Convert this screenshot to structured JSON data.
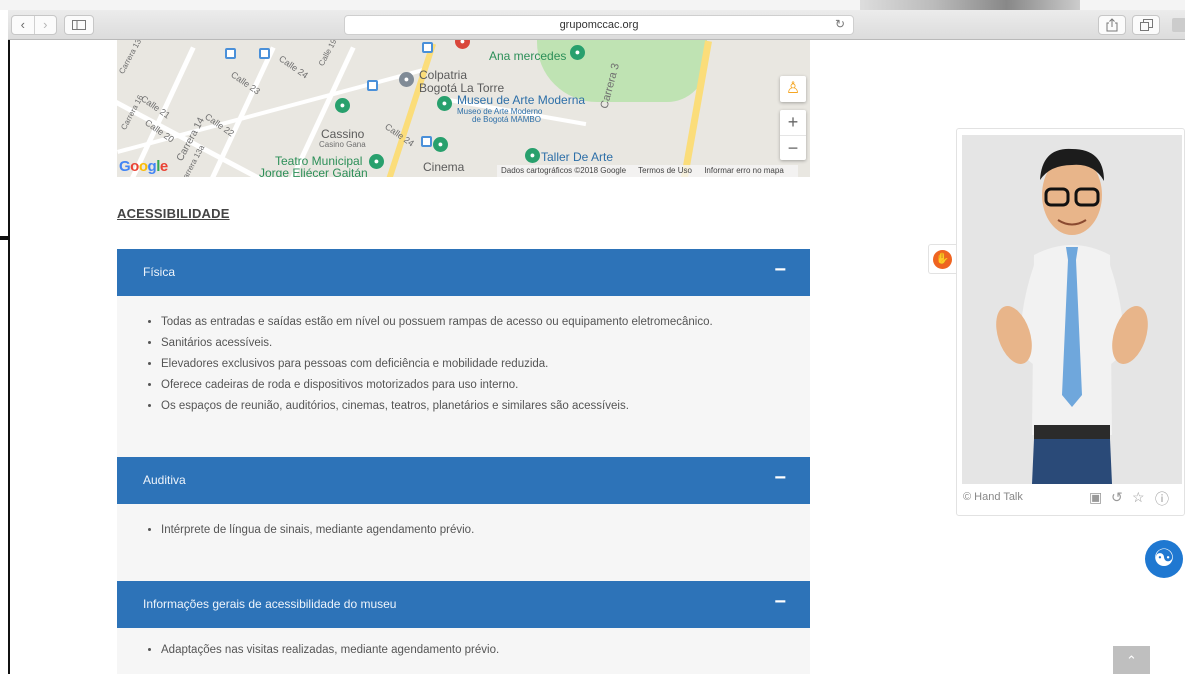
{
  "browser": {
    "url": "grupomccac.org",
    "back_icon": "chevron-left-icon",
    "forward_icon": "chevron-right-icon"
  },
  "map": {
    "labels": {
      "ana_mercedes": "Ana mercedes",
      "colpatria": "Colpatria",
      "bogota_la_torre": "Bogotá La Torre",
      "museu_title": "Museu de Arte Moderna",
      "museu_sub1": "Museo de Arte Moderno",
      "museu_sub2": "de Bogotá MAMBO",
      "cassino": "Cassino",
      "cassino_sub": "Casino Gana",
      "teatro1": "Teatro Municipal",
      "teatro2": "Jorge Eliécer Gaitán",
      "cinema": "Cinema",
      "taller": "Taller De Arte",
      "carrera3": "Carrera 3",
      "carrera14": "Carrera 14",
      "carrera13a": "Carrera 13a",
      "carrera16": "Carrera 16",
      "calle24": "Calle 24",
      "calle23": "Calle 23",
      "calle22": "Calle 22",
      "calle21": "Calle 21",
      "calle20": "Calle 20",
      "calle24b": "Calle 24",
      "calle19": "Calle 19",
      "carrera15": "Carrera 13"
    },
    "google": "Google",
    "attribution": {
      "data": "Dados cartográficos ©2018 Google",
      "terms": "Termos de Uso",
      "report": "Informar erro no mapa"
    },
    "zoom_in": "+",
    "zoom_out": "−"
  },
  "section_heading": "ACESSIBILIDADE",
  "accordions": [
    {
      "title": "Física",
      "toggle": "−",
      "items": [
        "Todas as entradas e saídas estão em nível ou possuem rampas de acesso ou equipamento eletromecânico.",
        "Sanitários acessíveis.",
        "Elevadores exclusivos para pessoas com deficiência e mobilidade reduzida.",
        "Oferece cadeiras de roda e dispositivos motorizados para uso interno.",
        "Os espaços de reunião, auditórios, cinemas, teatros, planetários e similares são acessíveis."
      ]
    },
    {
      "title": "Auditiva",
      "toggle": "−",
      "items": [
        "Intérprete de língua de sinais, mediante agendamento prévio."
      ]
    },
    {
      "title": "Informações gerais de acessibilidade do museu",
      "toggle": "−",
      "items": [
        "Adaptações nas visitas realizadas, mediante agendamento prévio."
      ]
    }
  ],
  "hand_talk": {
    "credit": "© Hand Talk"
  },
  "colors": {
    "accordion_header": "#2d73b8",
    "accordion_body": "#f6f6f6",
    "accessibility_button": "#1f78d1",
    "hand_talk_orange": "#ef6420"
  }
}
